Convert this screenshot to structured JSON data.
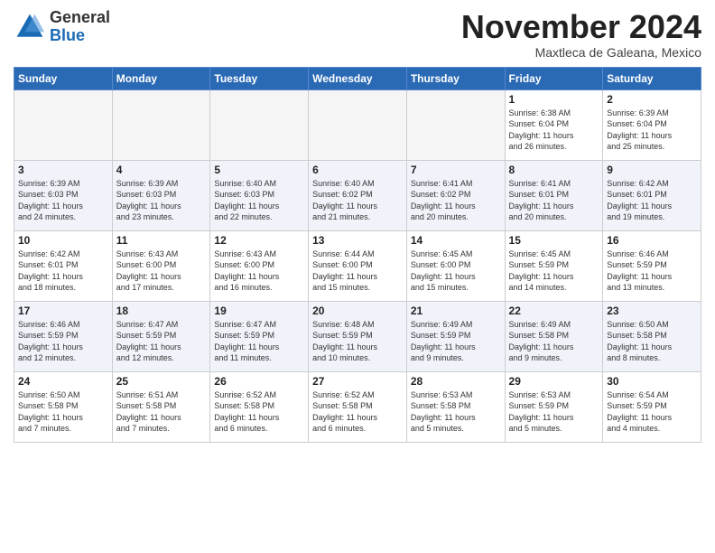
{
  "logo": {
    "general": "General",
    "blue": "Blue"
  },
  "title": "November 2024",
  "subtitle": "Maxtleca de Galeana, Mexico",
  "weekdays": [
    "Sunday",
    "Monday",
    "Tuesday",
    "Wednesday",
    "Thursday",
    "Friday",
    "Saturday"
  ],
  "weeks": [
    [
      {
        "day": "",
        "info": ""
      },
      {
        "day": "",
        "info": ""
      },
      {
        "day": "",
        "info": ""
      },
      {
        "day": "",
        "info": ""
      },
      {
        "day": "",
        "info": ""
      },
      {
        "day": "1",
        "info": "Sunrise: 6:38 AM\nSunset: 6:04 PM\nDaylight: 11 hours\nand 26 minutes."
      },
      {
        "day": "2",
        "info": "Sunrise: 6:39 AM\nSunset: 6:04 PM\nDaylight: 11 hours\nand 25 minutes."
      }
    ],
    [
      {
        "day": "3",
        "info": "Sunrise: 6:39 AM\nSunset: 6:03 PM\nDaylight: 11 hours\nand 24 minutes."
      },
      {
        "day": "4",
        "info": "Sunrise: 6:39 AM\nSunset: 6:03 PM\nDaylight: 11 hours\nand 23 minutes."
      },
      {
        "day": "5",
        "info": "Sunrise: 6:40 AM\nSunset: 6:03 PM\nDaylight: 11 hours\nand 22 minutes."
      },
      {
        "day": "6",
        "info": "Sunrise: 6:40 AM\nSunset: 6:02 PM\nDaylight: 11 hours\nand 21 minutes."
      },
      {
        "day": "7",
        "info": "Sunrise: 6:41 AM\nSunset: 6:02 PM\nDaylight: 11 hours\nand 20 minutes."
      },
      {
        "day": "8",
        "info": "Sunrise: 6:41 AM\nSunset: 6:01 PM\nDaylight: 11 hours\nand 20 minutes."
      },
      {
        "day": "9",
        "info": "Sunrise: 6:42 AM\nSunset: 6:01 PM\nDaylight: 11 hours\nand 19 minutes."
      }
    ],
    [
      {
        "day": "10",
        "info": "Sunrise: 6:42 AM\nSunset: 6:01 PM\nDaylight: 11 hours\nand 18 minutes."
      },
      {
        "day": "11",
        "info": "Sunrise: 6:43 AM\nSunset: 6:00 PM\nDaylight: 11 hours\nand 17 minutes."
      },
      {
        "day": "12",
        "info": "Sunrise: 6:43 AM\nSunset: 6:00 PM\nDaylight: 11 hours\nand 16 minutes."
      },
      {
        "day": "13",
        "info": "Sunrise: 6:44 AM\nSunset: 6:00 PM\nDaylight: 11 hours\nand 15 minutes."
      },
      {
        "day": "14",
        "info": "Sunrise: 6:45 AM\nSunset: 6:00 PM\nDaylight: 11 hours\nand 15 minutes."
      },
      {
        "day": "15",
        "info": "Sunrise: 6:45 AM\nSunset: 5:59 PM\nDaylight: 11 hours\nand 14 minutes."
      },
      {
        "day": "16",
        "info": "Sunrise: 6:46 AM\nSunset: 5:59 PM\nDaylight: 11 hours\nand 13 minutes."
      }
    ],
    [
      {
        "day": "17",
        "info": "Sunrise: 6:46 AM\nSunset: 5:59 PM\nDaylight: 11 hours\nand 12 minutes."
      },
      {
        "day": "18",
        "info": "Sunrise: 6:47 AM\nSunset: 5:59 PM\nDaylight: 11 hours\nand 12 minutes."
      },
      {
        "day": "19",
        "info": "Sunrise: 6:47 AM\nSunset: 5:59 PM\nDaylight: 11 hours\nand 11 minutes."
      },
      {
        "day": "20",
        "info": "Sunrise: 6:48 AM\nSunset: 5:59 PM\nDaylight: 11 hours\nand 10 minutes."
      },
      {
        "day": "21",
        "info": "Sunrise: 6:49 AM\nSunset: 5:59 PM\nDaylight: 11 hours\nand 9 minutes."
      },
      {
        "day": "22",
        "info": "Sunrise: 6:49 AM\nSunset: 5:58 PM\nDaylight: 11 hours\nand 9 minutes."
      },
      {
        "day": "23",
        "info": "Sunrise: 6:50 AM\nSunset: 5:58 PM\nDaylight: 11 hours\nand 8 minutes."
      }
    ],
    [
      {
        "day": "24",
        "info": "Sunrise: 6:50 AM\nSunset: 5:58 PM\nDaylight: 11 hours\nand 7 minutes."
      },
      {
        "day": "25",
        "info": "Sunrise: 6:51 AM\nSunset: 5:58 PM\nDaylight: 11 hours\nand 7 minutes."
      },
      {
        "day": "26",
        "info": "Sunrise: 6:52 AM\nSunset: 5:58 PM\nDaylight: 11 hours\nand 6 minutes."
      },
      {
        "day": "27",
        "info": "Sunrise: 6:52 AM\nSunset: 5:58 PM\nDaylight: 11 hours\nand 6 minutes."
      },
      {
        "day": "28",
        "info": "Sunrise: 6:53 AM\nSunset: 5:58 PM\nDaylight: 11 hours\nand 5 minutes."
      },
      {
        "day": "29",
        "info": "Sunrise: 6:53 AM\nSunset: 5:59 PM\nDaylight: 11 hours\nand 5 minutes."
      },
      {
        "day": "30",
        "info": "Sunrise: 6:54 AM\nSunset: 5:59 PM\nDaylight: 11 hours\nand 4 minutes."
      }
    ]
  ]
}
